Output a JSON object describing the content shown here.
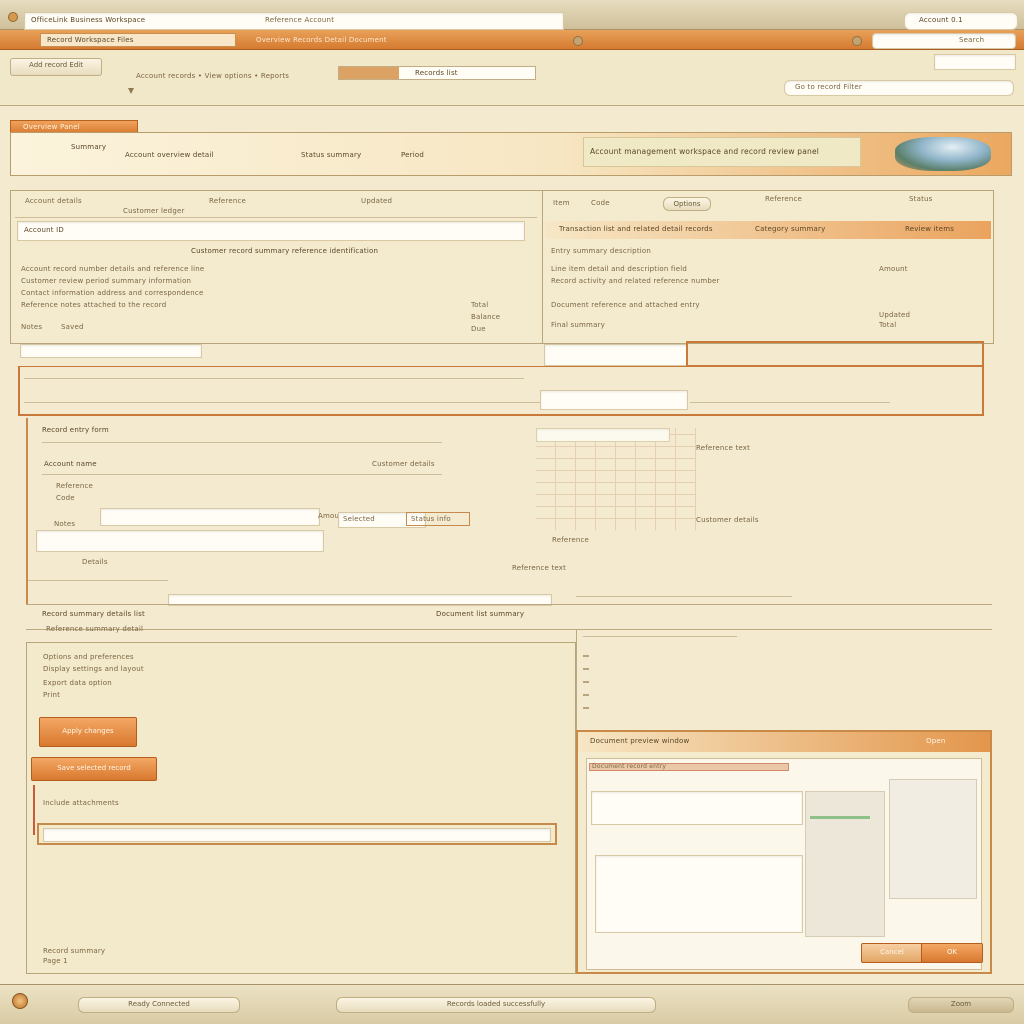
{
  "titlebar": {
    "title": "OfficeLink Business Workspace",
    "address_text": "Reference Account",
    "right_badge": "Account 0.1"
  },
  "toolbar": {
    "tab_active": "Record  Workspace  Files",
    "crumb": "Overview  Records  Detail  Document",
    "right_field": "Search",
    "sub_left_a": "Add record  Edit",
    "sub_left_b": "Account records • View options • Reports",
    "sub_pill": "Records list",
    "sub_right": "Go to record  Filter"
  },
  "banner": {
    "tab": "Overview Panel",
    "left_a": "Summary",
    "left_b": "Account overview detail",
    "left_c": "Status summary",
    "left_d": "Period",
    "center": "Account management workspace and record review panel"
  },
  "left_section": {
    "head_a": "Account details",
    "head_b": "Customer ledger",
    "head_c": "Reference",
    "head_d": "Updated",
    "row1_label": "Account ID",
    "row1_text": "Customer record summary reference identification",
    "body_lines": [
      "Account record number details and reference line",
      "Customer review period summary information",
      "Contact information address and correspondence",
      "Reference notes attached to the record"
    ],
    "body_right": [
      "Total",
      "Balance",
      "Due"
    ],
    "tail_a": "Notes",
    "tail_b": "Saved"
  },
  "right_section": {
    "header_a": "Item",
    "header_b": "Code",
    "header_pill": "Options",
    "header_c": "Reference",
    "header_d": "Status",
    "orange_a": "Transaction list and related detail records",
    "orange_b": "Category summary",
    "orange_c": "Review items",
    "lines": [
      "Entry summary description",
      "Line item detail and description field",
      "Record activity and related reference number",
      "Document reference and attached entry",
      "Final summary"
    ],
    "right_col": [
      "Amount",
      "Updated",
      "Total"
    ]
  },
  "form": {
    "title": "Record entry form",
    "label_a": "Account name",
    "label_b": "Customer details",
    "label_c": "Reference",
    "label_d": "Code",
    "label_e": "Amount",
    "label_f": "Notes",
    "tag_a": "Selected",
    "tag_b": "Status info",
    "side_a": "Details",
    "side_b": "Reference text",
    "bottom_a": "Record summary details list",
    "bottom_b": "Reference summary detail",
    "bottom_c": "Document list summary"
  },
  "options": {
    "lines": [
      "Options and preferences",
      "Display settings and layout",
      "Export data option",
      "Print"
    ],
    "button_a": "Apply changes",
    "button_b": "Save selected record",
    "check_label": "Include attachments",
    "footer_a": "Record summary",
    "footer_b": "Page 1"
  },
  "preview": {
    "header": "Document preview window",
    "header_right": "Open",
    "doc_line": "Document record entry",
    "btn_a": "Cancel",
    "btn_b": "OK"
  },
  "statusbar": {
    "left": "Ready  Connected",
    "center": "Records loaded successfully",
    "right": "Zoom"
  },
  "colors": {
    "background": "#f3ead0",
    "accent": "#e08a3c",
    "frame": "#a8926a",
    "field": "#fffdf6"
  }
}
